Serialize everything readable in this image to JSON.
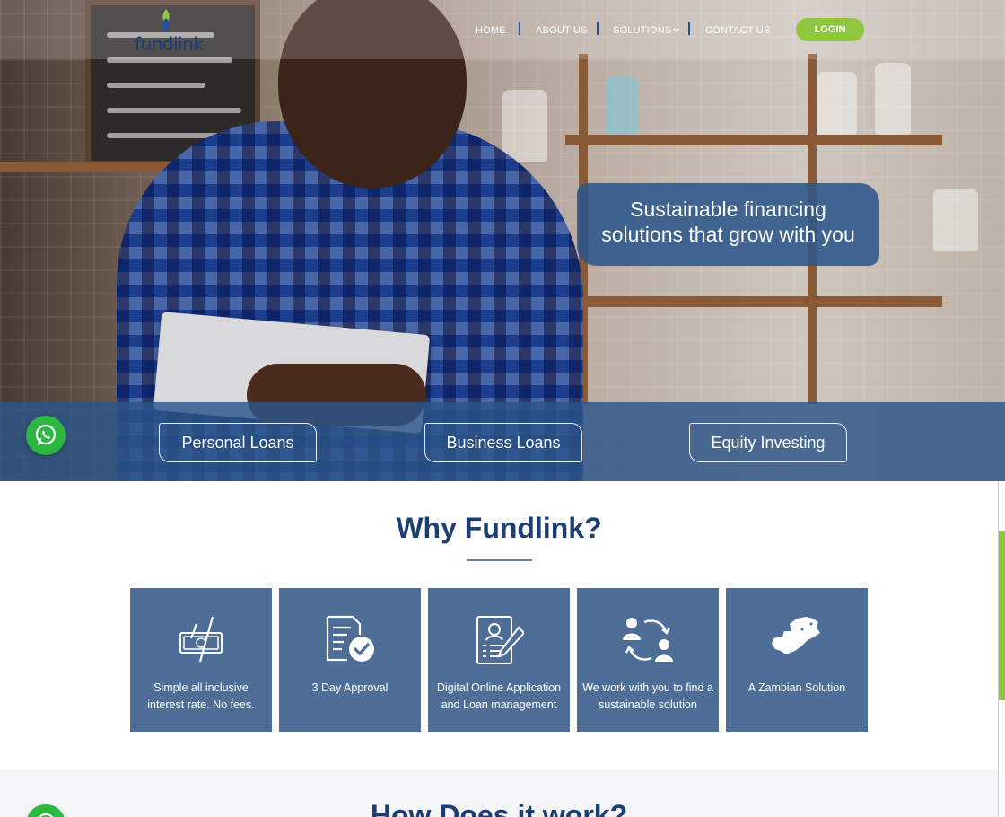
{
  "brand": {
    "name": "fundlink",
    "logo_colors": {
      "leaf_green": "#8ec63f",
      "leaf_blue": "#1f4fa0",
      "text": "#1a3d7a"
    }
  },
  "nav": {
    "items": [
      {
        "label": "HOME"
      },
      {
        "label": "ABOUT US"
      },
      {
        "label": "SOLUTIONS"
      },
      {
        "label": "CONTACT US"
      }
    ],
    "login_label": "LOGIN"
  },
  "hero": {
    "tagline_line1": "Sustainable financing",
    "tagline_line2": "solutions that grow with you"
  },
  "loan_buttons": [
    {
      "label": "Personal Loans"
    },
    {
      "label": "Business Loans"
    },
    {
      "label": "Equity Investing"
    }
  ],
  "why": {
    "title": "Why Fundlink?",
    "features": [
      {
        "icon": "money-rate-icon",
        "text": "Simple all inclusive interest rate. No fees."
      },
      {
        "icon": "document-check-icon",
        "text": "3 Day Approval"
      },
      {
        "icon": "online-application-icon",
        "text": "Digital Online Application and Loan management"
      },
      {
        "icon": "people-exchange-icon",
        "text": "We work with you to find a sustainable solution"
      },
      {
        "icon": "zambia-map-icon",
        "text": "A Zambian Solution"
      }
    ]
  },
  "how": {
    "title": "How Does it work?"
  },
  "colors": {
    "accent_green": "#8ec63f",
    "primary_blue": "#1c3f73",
    "card_blue": "#4e6e97",
    "whatsapp_green": "#2bb741"
  }
}
